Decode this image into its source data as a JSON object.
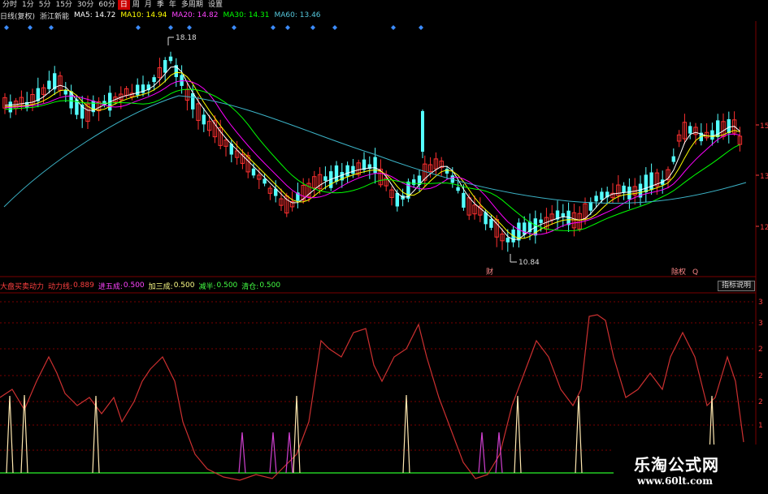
{
  "toolbar": {
    "tabs": [
      "分时",
      "1分",
      "5分",
      "15分",
      "30分",
      "60分",
      "日",
      "周",
      "月",
      "季",
      "年",
      "多周期",
      "设置"
    ],
    "active_index": 6
  },
  "info": {
    "label": "日线(复权)",
    "stock_name": "浙江新能",
    "ma5": "MA5: 14.72",
    "ma10": "MA10: 14.94",
    "ma20": "MA20: 14.82",
    "ma30": "MA30: 14.31",
    "ma60": "MA60: 13.46"
  },
  "price_chart": {
    "high_label": "18.18",
    "low_label": "10.84",
    "marker_cai": "财",
    "marker_right": "除权",
    "marker_q": "Q",
    "right_ticks": [
      "15",
      "13",
      "12"
    ],
    "colors": {
      "up": "#ff3030",
      "down": "#54ffff",
      "ma5": "#ffffff",
      "ma10": "#ffff00",
      "ma20": "#ff00ff",
      "ma30": "#00ff00",
      "ma60": "#3cb4c8"
    }
  },
  "indicator": {
    "name": "大盘买卖动力",
    "line1": "动力线:",
    "line1_value": "0.889",
    "line2": "进五成:",
    "line2_value": "0.500",
    "line3": "加三成:",
    "line3_value": "0.500",
    "line4": "减半:",
    "line4_value": "0.500",
    "line5": "清仓:",
    "line5_value": "0.500",
    "help_button": "指标说明",
    "right_ticks": [
      "3",
      "3",
      "2",
      "2",
      "2",
      "1",
      "1"
    ]
  },
  "watermark": {
    "title": "乐淘公式网",
    "url": "www.60lt.com"
  }
}
